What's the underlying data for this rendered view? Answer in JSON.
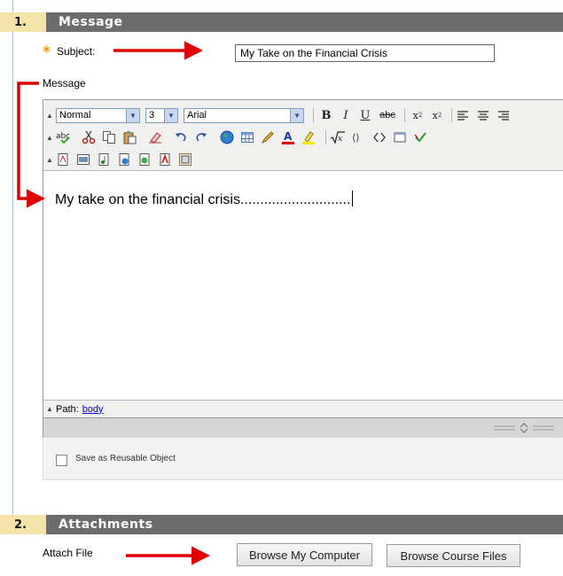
{
  "message_section": {
    "number": "1.",
    "title": "Message",
    "subject_label": "Subject:",
    "subject_value": "My Take on the Financial Crisis",
    "message_label": "Message"
  },
  "toolbar": {
    "format_value": "Normal",
    "size_value": "3",
    "font_value": "Arial",
    "bold": "B",
    "italic": "I",
    "underline": "U",
    "strikethrough": "abc"
  },
  "editor": {
    "content": "My take on the financial crisis............................",
    "path_label": "Path:",
    "path_link": "body"
  },
  "reusable_object": {
    "label": "Save as Reusable Object"
  },
  "attachments_section": {
    "number": "2.",
    "title": "Attachments",
    "attach_label": "Attach File",
    "browse_computer": "Browse My Computer",
    "browse_course": "Browse Course Files"
  },
  "colors": {
    "header_bg": "#6c6c6c",
    "number_bg": "#f4e3a9",
    "required_star": "#f29a00",
    "annotation_arrow": "#e00000",
    "link": "#0000cc"
  }
}
